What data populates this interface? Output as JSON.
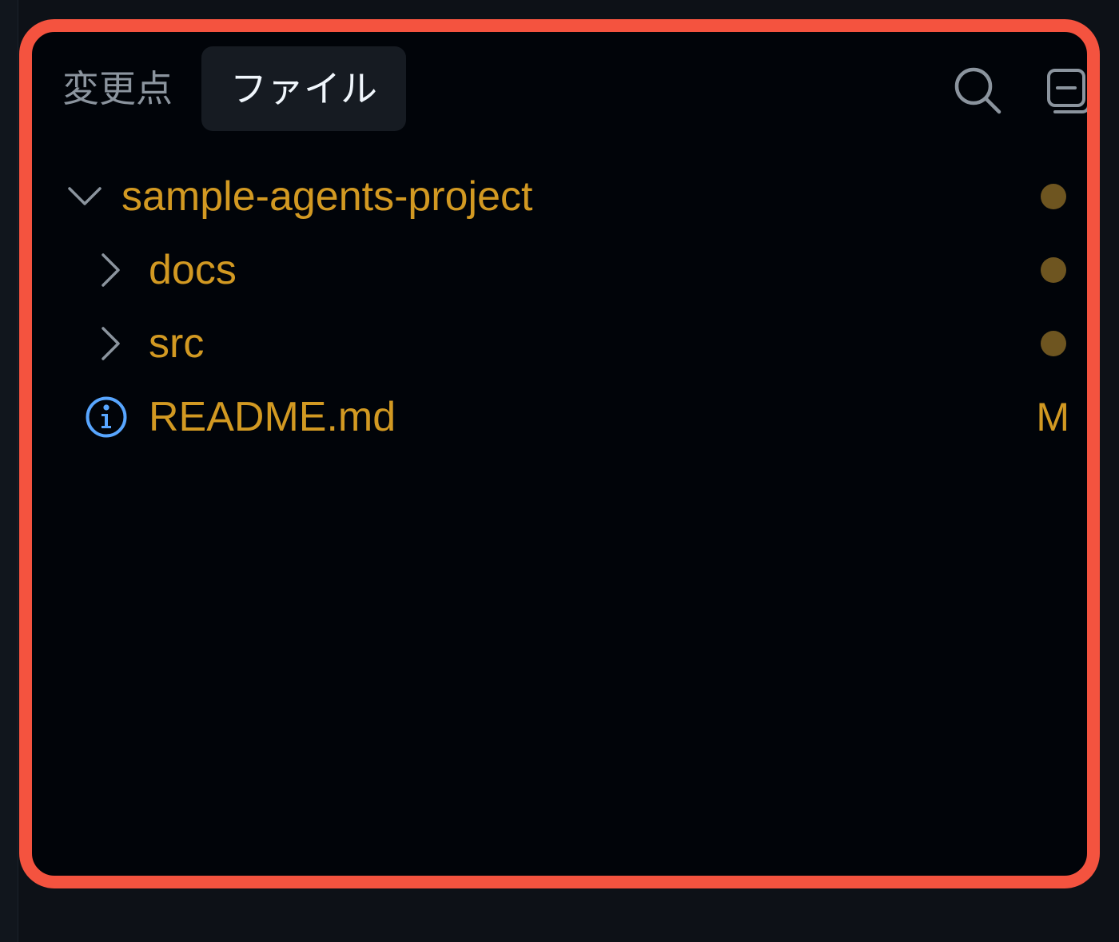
{
  "tabs": [
    {
      "label": "変更点",
      "active": false
    },
    {
      "label": "ファイル",
      "active": true
    }
  ],
  "toolbar": {
    "search_icon": "search-icon",
    "collapse_icon": "collapse-all-icon"
  },
  "tree": {
    "root": {
      "label": "sample-agents-project",
      "expanded": true,
      "status": "modified-dot"
    },
    "items": [
      {
        "label": "docs",
        "type": "folder",
        "expanded": false,
        "status": "modified-dot"
      },
      {
        "label": "src",
        "type": "folder",
        "expanded": false,
        "status": "modified-dot"
      },
      {
        "label": "README.md",
        "type": "file",
        "icon": "info-icon",
        "status_letter": "M"
      }
    ]
  },
  "colors": {
    "accent": "#f4533f",
    "modified_text": "#d29922",
    "modified_dot": "#6e5520",
    "info_icon": "#58a6ff",
    "panel_bg": "#010409"
  }
}
